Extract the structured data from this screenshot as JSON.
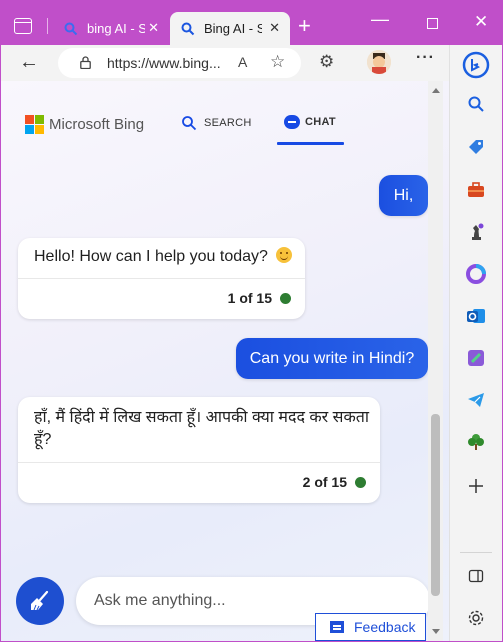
{
  "tabs": [
    {
      "title": "bing AI - S",
      "close": "✕"
    },
    {
      "title": "Bing AI - S",
      "close": "✕"
    }
  ],
  "new_tab": "+",
  "window": {
    "minimize": "—",
    "close": "✕"
  },
  "toolbar": {
    "back": "←",
    "url": "https://www.bing...",
    "read_aloud": "A",
    "favorite": "☆",
    "extensions": "⚙",
    "more": "···"
  },
  "header": {
    "logo_text": "Microsoft Bing",
    "search_tab": "SEARCH",
    "chat_tab": "CHAT"
  },
  "conversation": [
    {
      "role": "user",
      "text": "Hi,"
    },
    {
      "role": "bot",
      "text": "Hello! How can I help you today?",
      "count": "1 of 15"
    },
    {
      "role": "user",
      "text": "Can you write in Hindi?"
    },
    {
      "role": "bot",
      "text": "हाँ, मैं हिंदी में लिख सकता हूँ। आपकी क्या मदद कर सकता हूँ?",
      "count": "2 of 15"
    }
  ],
  "input": {
    "placeholder": "Ask me anything..."
  },
  "feedback": {
    "label": "Feedback"
  },
  "colors": {
    "accent": "#174ae4",
    "frame": "#c04fc9",
    "status_dot": "#2e7d32"
  },
  "sidebar_icons": [
    "bing-chat-icon",
    "search-icon",
    "shopping-tag-icon",
    "tools-icon",
    "games-icon",
    "office-icon",
    "outlook-icon",
    "designer-icon",
    "telegram-icon",
    "tree-icon",
    "add-icon",
    "split-view-icon",
    "settings-icon"
  ]
}
